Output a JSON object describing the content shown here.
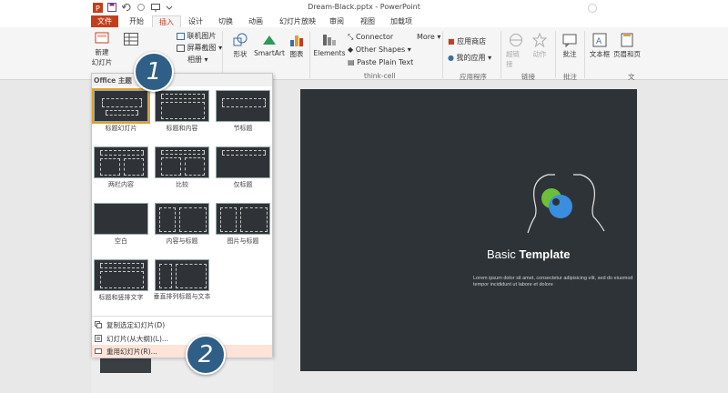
{
  "window": {
    "title": "Dream-Black.pptx - PowerPoint"
  },
  "tabs": [
    "文件",
    "开始",
    "插入",
    "设计",
    "切换",
    "动画",
    "幻灯片放映",
    "审阅",
    "视图",
    "加载项"
  ],
  "ribbon": {
    "new_slide_line1": "新建",
    "new_slide_line2": "幻灯片",
    "online_pictures": "联机图片",
    "screenshot": "屏幕截图",
    "album": "相册",
    "shapes": "形状",
    "smartart": "SmartArt",
    "chart": "图表",
    "elements": "Elements",
    "connector": "Connector",
    "other_shapes": "Other Shapes",
    "paste_plain_text": "Paste Plain Text",
    "more": "More",
    "think_cell_label": "think-cell",
    "app_store": "应用商店",
    "my_apps": "我的应用",
    "apps_group": "应用程序",
    "hyperlink": "超链接",
    "action": "动作",
    "links_group": "链接",
    "comment": "批注",
    "comment_group": "批注",
    "textbox": "文本框",
    "header_footer": "页眉和页",
    "text_group": "文"
  },
  "gallery": {
    "header": "Office 主题",
    "layouts": [
      "标题幻灯片",
      "标题和内容",
      "节标题",
      "两栏内容",
      "比较",
      "仅标题",
      "空白",
      "内容与标题",
      "图片与标题",
      "标题和竖排文字",
      "垂直排列标题与文本"
    ],
    "menu": [
      "复制选定幻灯片(D)",
      "幻灯片(从大纲)(L)...",
      "重用幻灯片(R)..."
    ]
  },
  "slide": {
    "title_normal": "Basic ",
    "title_bold": "Template",
    "subtitle": "Lorem ipsum dolor sit amet, consectetur adipisicing elit, sed do eiusmod tempor incididunt ut labore et dolore"
  },
  "badges": [
    "1",
    "2"
  ],
  "colors": {
    "accent": "#c43e1c",
    "slide_bg": "#2e3337",
    "badge": "#2f5f86",
    "logo_green": "#6cbf3a",
    "logo_blue": "#3a8ee0"
  }
}
